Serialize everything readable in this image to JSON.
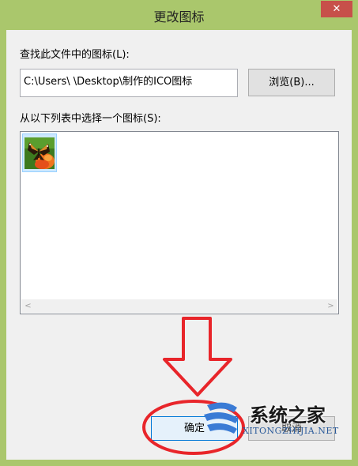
{
  "window": {
    "title": "更改图标",
    "close_glyph": "✕"
  },
  "find": {
    "label": "查找此文件中的图标(L):",
    "path_value": "C:\\Users\\        \\Desktop\\制作的ICO图标",
    "browse_label": "浏览(B)..."
  },
  "list": {
    "label": "从以下列表中选择一个图标(S):",
    "icons": [
      {
        "name": "butterfly-flower-icon"
      }
    ],
    "scroll_left": "<",
    "scroll_right": ">"
  },
  "buttons": {
    "ok_label": "确定",
    "cancel_label": "取消"
  },
  "annotation": {
    "arrow_color": "#e8252a",
    "circle_color": "#e8252a"
  },
  "watermark": {
    "text": "系统之家",
    "url": "XITONGZHIJIA.NET"
  }
}
